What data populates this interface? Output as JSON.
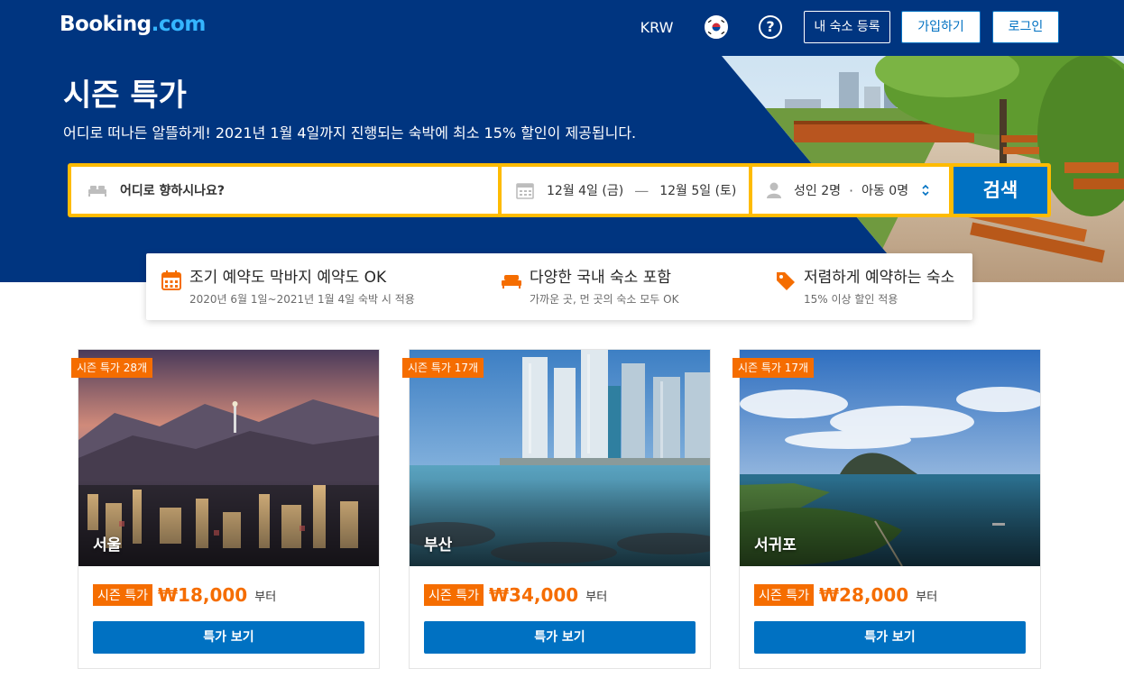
{
  "header": {
    "logo_main": "Booking",
    "logo_dot": ".com",
    "currency": "KRW",
    "flag_icon": "korea-flag-icon",
    "help_icon": "help-icon",
    "help_glyph": "?",
    "list_property": "내 숙소 등록",
    "signup": "가입하기",
    "login": "로그인"
  },
  "hero": {
    "title": "시즌 특가",
    "subtitle": "어디로 떠나든 알뜰하게! 2021년 1월 4일까지 진행되는 숙박에 최소 15% 할인이 제공됩니다."
  },
  "search": {
    "destination_placeholder": "어디로 향하시나요?",
    "checkin": "12월 4일 (금)",
    "date_separator": "—",
    "checkout": "12월 5일 (토)",
    "adults": "성인 2명",
    "guest_separator": "·",
    "children": "아동 0명",
    "button": "검색"
  },
  "features": [
    {
      "icon": "calendar-icon",
      "title": "조기 예약도 막바지 예약도 OK",
      "desc": "2020년 6월 1일~2021년 1월 4일 숙박 시 적용"
    },
    {
      "icon": "bed-icon",
      "title": "다양한 국내 숙소 포함",
      "desc": "가까운 곳, 먼 곳의 숙소 모두 OK"
    },
    {
      "icon": "price-tag-icon",
      "title": "저렴하게 예약하는 숙소",
      "desc": "15% 이상 할인 적용"
    }
  ],
  "cards": [
    {
      "badge": "시즌 특가 28개",
      "city": "서울",
      "tag": "시즌 특가",
      "price": "₩18,000",
      "from": "부터",
      "button": "특가 보기"
    },
    {
      "badge": "시즌 특가 17개",
      "city": "부산",
      "tag": "시즌 특가",
      "price": "₩34,000",
      "from": "부터",
      "button": "특가 보기"
    },
    {
      "badge": "시즌 특가 17개",
      "city": "서귀포",
      "tag": "시즌 특가",
      "price": "₩28,000",
      "from": "부터",
      "button": "특가 보기"
    }
  ],
  "colors": {
    "brand_blue": "#003580",
    "action_blue": "#0071c2",
    "accent_orange": "#f56d00",
    "search_yellow": "#febb02"
  }
}
